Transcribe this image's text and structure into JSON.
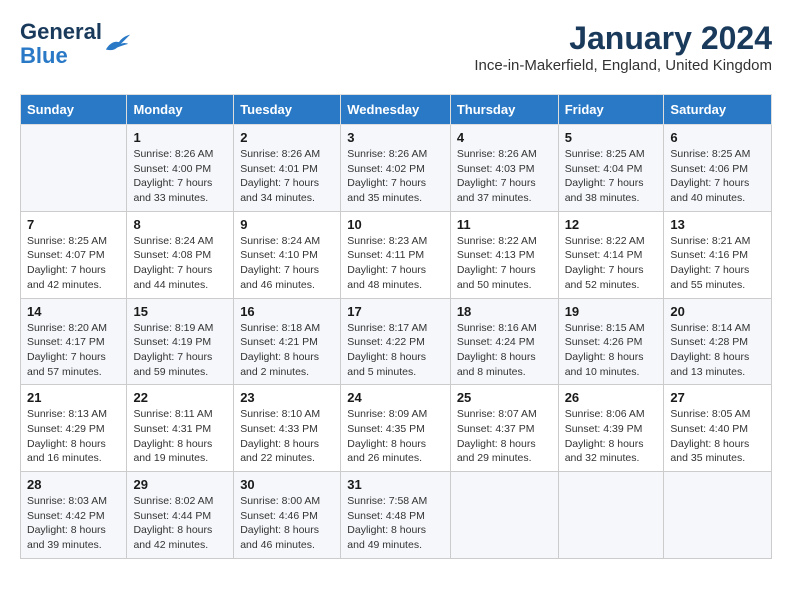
{
  "header": {
    "logo_line1": "General",
    "logo_line2": "Blue",
    "month_title": "January 2024",
    "location": "Ince-in-Makerfield, England, United Kingdom"
  },
  "columns": [
    "Sunday",
    "Monday",
    "Tuesday",
    "Wednesday",
    "Thursday",
    "Friday",
    "Saturday"
  ],
  "weeks": [
    [
      {
        "day": "",
        "info": ""
      },
      {
        "day": "1",
        "info": "Sunrise: 8:26 AM\nSunset: 4:00 PM\nDaylight: 7 hours\nand 33 minutes."
      },
      {
        "day": "2",
        "info": "Sunrise: 8:26 AM\nSunset: 4:01 PM\nDaylight: 7 hours\nand 34 minutes."
      },
      {
        "day": "3",
        "info": "Sunrise: 8:26 AM\nSunset: 4:02 PM\nDaylight: 7 hours\nand 35 minutes."
      },
      {
        "day": "4",
        "info": "Sunrise: 8:26 AM\nSunset: 4:03 PM\nDaylight: 7 hours\nand 37 minutes."
      },
      {
        "day": "5",
        "info": "Sunrise: 8:25 AM\nSunset: 4:04 PM\nDaylight: 7 hours\nand 38 minutes."
      },
      {
        "day": "6",
        "info": "Sunrise: 8:25 AM\nSunset: 4:06 PM\nDaylight: 7 hours\nand 40 minutes."
      }
    ],
    [
      {
        "day": "7",
        "info": "Sunrise: 8:25 AM\nSunset: 4:07 PM\nDaylight: 7 hours\nand 42 minutes."
      },
      {
        "day": "8",
        "info": "Sunrise: 8:24 AM\nSunset: 4:08 PM\nDaylight: 7 hours\nand 44 minutes."
      },
      {
        "day": "9",
        "info": "Sunrise: 8:24 AM\nSunset: 4:10 PM\nDaylight: 7 hours\nand 46 minutes."
      },
      {
        "day": "10",
        "info": "Sunrise: 8:23 AM\nSunset: 4:11 PM\nDaylight: 7 hours\nand 48 minutes."
      },
      {
        "day": "11",
        "info": "Sunrise: 8:22 AM\nSunset: 4:13 PM\nDaylight: 7 hours\nand 50 minutes."
      },
      {
        "day": "12",
        "info": "Sunrise: 8:22 AM\nSunset: 4:14 PM\nDaylight: 7 hours\nand 52 minutes."
      },
      {
        "day": "13",
        "info": "Sunrise: 8:21 AM\nSunset: 4:16 PM\nDaylight: 7 hours\nand 55 minutes."
      }
    ],
    [
      {
        "day": "14",
        "info": "Sunrise: 8:20 AM\nSunset: 4:17 PM\nDaylight: 7 hours\nand 57 minutes."
      },
      {
        "day": "15",
        "info": "Sunrise: 8:19 AM\nSunset: 4:19 PM\nDaylight: 7 hours\nand 59 minutes."
      },
      {
        "day": "16",
        "info": "Sunrise: 8:18 AM\nSunset: 4:21 PM\nDaylight: 8 hours\nand 2 minutes."
      },
      {
        "day": "17",
        "info": "Sunrise: 8:17 AM\nSunset: 4:22 PM\nDaylight: 8 hours\nand 5 minutes."
      },
      {
        "day": "18",
        "info": "Sunrise: 8:16 AM\nSunset: 4:24 PM\nDaylight: 8 hours\nand 8 minutes."
      },
      {
        "day": "19",
        "info": "Sunrise: 8:15 AM\nSunset: 4:26 PM\nDaylight: 8 hours\nand 10 minutes."
      },
      {
        "day": "20",
        "info": "Sunrise: 8:14 AM\nSunset: 4:28 PM\nDaylight: 8 hours\nand 13 minutes."
      }
    ],
    [
      {
        "day": "21",
        "info": "Sunrise: 8:13 AM\nSunset: 4:29 PM\nDaylight: 8 hours\nand 16 minutes."
      },
      {
        "day": "22",
        "info": "Sunrise: 8:11 AM\nSunset: 4:31 PM\nDaylight: 8 hours\nand 19 minutes."
      },
      {
        "day": "23",
        "info": "Sunrise: 8:10 AM\nSunset: 4:33 PM\nDaylight: 8 hours\nand 22 minutes."
      },
      {
        "day": "24",
        "info": "Sunrise: 8:09 AM\nSunset: 4:35 PM\nDaylight: 8 hours\nand 26 minutes."
      },
      {
        "day": "25",
        "info": "Sunrise: 8:07 AM\nSunset: 4:37 PM\nDaylight: 8 hours\nand 29 minutes."
      },
      {
        "day": "26",
        "info": "Sunrise: 8:06 AM\nSunset: 4:39 PM\nDaylight: 8 hours\nand 32 minutes."
      },
      {
        "day": "27",
        "info": "Sunrise: 8:05 AM\nSunset: 4:40 PM\nDaylight: 8 hours\nand 35 minutes."
      }
    ],
    [
      {
        "day": "28",
        "info": "Sunrise: 8:03 AM\nSunset: 4:42 PM\nDaylight: 8 hours\nand 39 minutes."
      },
      {
        "day": "29",
        "info": "Sunrise: 8:02 AM\nSunset: 4:44 PM\nDaylight: 8 hours\nand 42 minutes."
      },
      {
        "day": "30",
        "info": "Sunrise: 8:00 AM\nSunset: 4:46 PM\nDaylight: 8 hours\nand 46 minutes."
      },
      {
        "day": "31",
        "info": "Sunrise: 7:58 AM\nSunset: 4:48 PM\nDaylight: 8 hours\nand 49 minutes."
      },
      {
        "day": "",
        "info": ""
      },
      {
        "day": "",
        "info": ""
      },
      {
        "day": "",
        "info": ""
      }
    ]
  ]
}
